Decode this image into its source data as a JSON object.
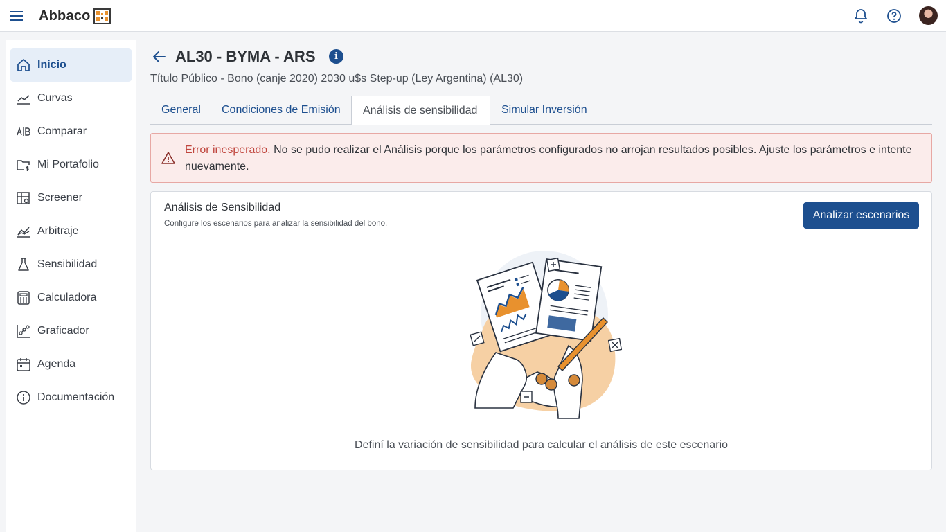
{
  "app": {
    "brand": "Abbaco"
  },
  "sidebar": {
    "items": [
      {
        "label": "Inicio",
        "icon": "home-icon",
        "active": true
      },
      {
        "label": "Curvas",
        "icon": "chart-line-icon"
      },
      {
        "label": "Comparar",
        "icon": "compare-ab-icon"
      },
      {
        "label": "Mi Portafolio",
        "icon": "folder-money-icon"
      },
      {
        "label": "Screener",
        "icon": "screener-icon"
      },
      {
        "label": "Arbitraje",
        "icon": "arbitrage-chart-icon"
      },
      {
        "label": "Sensibilidad",
        "icon": "flask-icon"
      },
      {
        "label": "Calculadora",
        "icon": "calculator-icon"
      },
      {
        "label": "Graficador",
        "icon": "graph-nodes-icon"
      },
      {
        "label": "Agenda",
        "icon": "calendar-icon"
      },
      {
        "label": "Documentación",
        "icon": "info-circle-icon"
      }
    ]
  },
  "header": {
    "title": "AL30 - BYMA - ARS",
    "subtitle": "Título Público - Bono (canje 2020) 2030 u$s Step-up (Ley Argentina) (AL30)",
    "info_glyph": "i"
  },
  "tabs": [
    {
      "label": "General"
    },
    {
      "label": "Condiciones de Emisión"
    },
    {
      "label": "Análisis de sensibilidad",
      "active": true
    },
    {
      "label": "Simular Inversión"
    }
  ],
  "alert": {
    "title": "Error inesperado.",
    "message": " No se pudo realizar el Análisis porque los parámetros configurados no arrojan resultados posibles. Ajuste los parámetros e intente nuevamente."
  },
  "card": {
    "title": "Análisis de Sensibilidad",
    "subtitle": "Configure los escenarios para analizar la sensibilidad del bono.",
    "button_label": "Analizar escenarios",
    "empty_message": "Definí la variación de sensibilidad para calcular el análisis de este escenario"
  },
  "colors": {
    "primary": "#1d4f8f",
    "error": "#c0463e",
    "accent_orange": "#e8912e"
  }
}
